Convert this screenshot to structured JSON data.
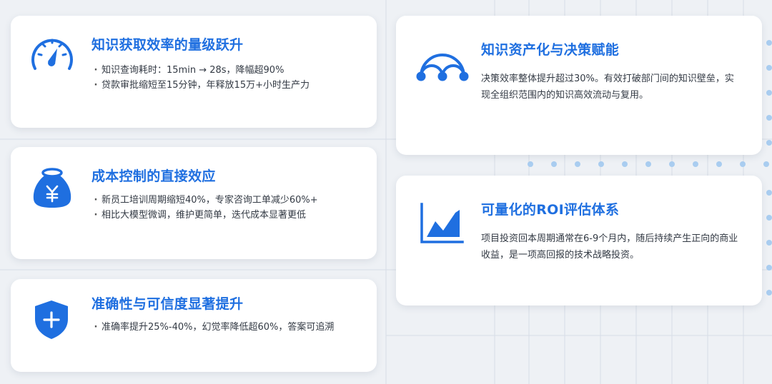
{
  "cards": [
    {
      "icon": "speedometer-icon",
      "title": "知识获取效率的量级跃升",
      "bullets": [
        "知识查询耗时：15min → 28s，降幅超90%",
        "贷款审批缩短至15分钟，年释放15万+小时生产力"
      ]
    },
    {
      "icon": "money-bag-icon",
      "title": "成本控制的直接效应",
      "bullets": [
        "新员工培训周期缩短40%，专家咨询工单减少60%+",
        "相比大模型微调，维护更简单，迭代成本显著更低"
      ]
    },
    {
      "icon": "shield-plus-icon",
      "title": "准确性与可信度显著提升",
      "bullets": [
        "准确率提升25%-40%，幻觉率降低超60%，答案可追溯"
      ]
    },
    {
      "icon": "network-arch-icon",
      "title": "知识资产化与决策赋能",
      "text": "决策效率整体提升超过30%。有效打破部门间的知识壁垒，实现全组织范围内的知识高效流动与复用。"
    },
    {
      "icon": "area-chart-icon",
      "title": "可量化的ROI评估体系",
      "text": "项目投资回本周期通常在6-9个月内，随后持续产生正向的商业收益，是一项高回报的技术战略投资。"
    }
  ],
  "colors": {
    "accent": "#1f6fe0",
    "text": "#333a44",
    "background": "#eef1f5"
  }
}
